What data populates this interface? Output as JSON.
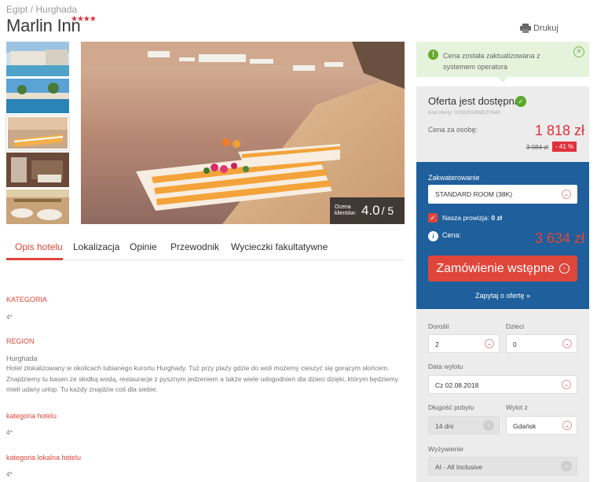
{
  "breadcrumb": "Egipt / Hurghada",
  "hotel": {
    "name": "Marlin Inn",
    "stars": "★★★★",
    "stars_value": 4
  },
  "print_label": "Drukuj",
  "rating": {
    "label": "Ocena klientów:",
    "value": "4.0",
    "max": "/ 5"
  },
  "tabs": [
    "Opis hotelu",
    "Lokalizacja",
    "Opinie",
    "Przewodnik",
    "Wycieczki fakultatywne"
  ],
  "sections": {
    "kategoria": {
      "title": "KATEGORIA",
      "value": "4*"
    },
    "region": {
      "title": "REGION",
      "value": "Hurghada"
    },
    "description": "Hotel zlokalizowany w okolicach lubianego kurortu Hurghady. Tuż przy plaży gdzie do woli możemy cieszyć się gorącym słońcem. Znajdziemy tu basen ze słodką wodą, restauracje z pysznym jedzeniem a także wiele udogodnień dla dzieci dzięki, którym będziemy mieli udany urlop. Tu każdy znajdzie coś dla siebie.",
    "kategoria_hotelu": {
      "title": "kategoria hotelu",
      "value": "4*"
    },
    "kategoria_lokalna": {
      "title": "kategoria lokalna hotelu",
      "value": "4*"
    }
  },
  "notice": {
    "text": "Cena została zaktualizowana z systemem operatora"
  },
  "offer": {
    "title": "Oferta jest dostępna!",
    "code": "Kod oferty: 02082018WEZY548",
    "per_person_label": "Cena za osobę:",
    "price": "1 818 zł",
    "old_price": "3 084 zł",
    "discount": "- 41 %"
  },
  "booking": {
    "accommodation_label": "Zakwaterowanie",
    "accommodation_value": "STANDARD ROOM (38K)",
    "commission_label": "Nasza prowizja:",
    "commission_value": "0 zł",
    "price_label": "Cena:",
    "price": "3 634 zł",
    "order_button": "Zamówienie wstępne",
    "ask_link": "Zapytaj o ofertę »"
  },
  "filters": {
    "adults_label": "Dorośli",
    "adults_value": "2",
    "children_label": "Dzieci",
    "children_value": "0",
    "departure_label": "Data wylotu",
    "departure_value": "Cz 02.08.2018",
    "duration_label": "Długość pobytu",
    "duration_value": "14 dni",
    "from_label": "Wylot z",
    "from_value": "Gdańsk",
    "board_label": "Wyżywienie",
    "board_value": "AI - All Inclusive"
  },
  "colors": {
    "accent": "#e0453a",
    "booking_bg": "#1e5f9c",
    "notice_bg": "#e6f3dc"
  }
}
